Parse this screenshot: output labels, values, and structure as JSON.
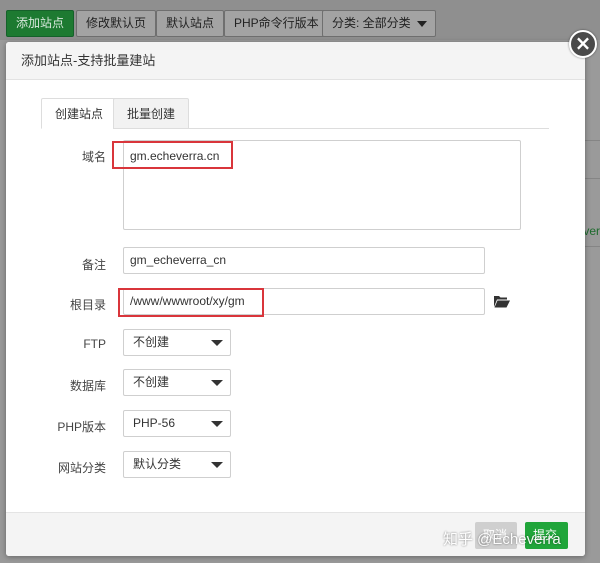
{
  "background": {
    "toolbar": {
      "add_site": "添加站点",
      "edit_default_page": "修改默认页",
      "default_site": "默认站点",
      "php_cli_version": "PHP命令行版本",
      "category_select": "分类: 全部分类"
    },
    "side_text": "ver"
  },
  "modal": {
    "title": "添加站点-支持批量建站",
    "tabs": [
      "创建站点",
      "批量创建"
    ],
    "form": {
      "domain_label": "域名",
      "domain_value": "gm.echeverra.cn",
      "remark_label": "备注",
      "remark_value": "gm_echeverra_cn",
      "root_label": "根目录",
      "root_value": "/www/wwwroot/xy/gm",
      "ftp_label": "FTP",
      "ftp_value": "不创建",
      "db_label": "数据库",
      "db_value": "不创建",
      "php_label": "PHP版本",
      "php_value": "PHP-56",
      "category_label": "网站分类",
      "category_value": "默认分类"
    },
    "footer": {
      "cancel_label": "取消",
      "submit_label": "提交"
    }
  },
  "watermark": "知乎 @Echeverra",
  "colors": {
    "accent_green": "#20a53a",
    "highlight_red": "#d9353b"
  },
  "icons": {
    "folder": "folder-open-icon",
    "close": "close-icon"
  }
}
